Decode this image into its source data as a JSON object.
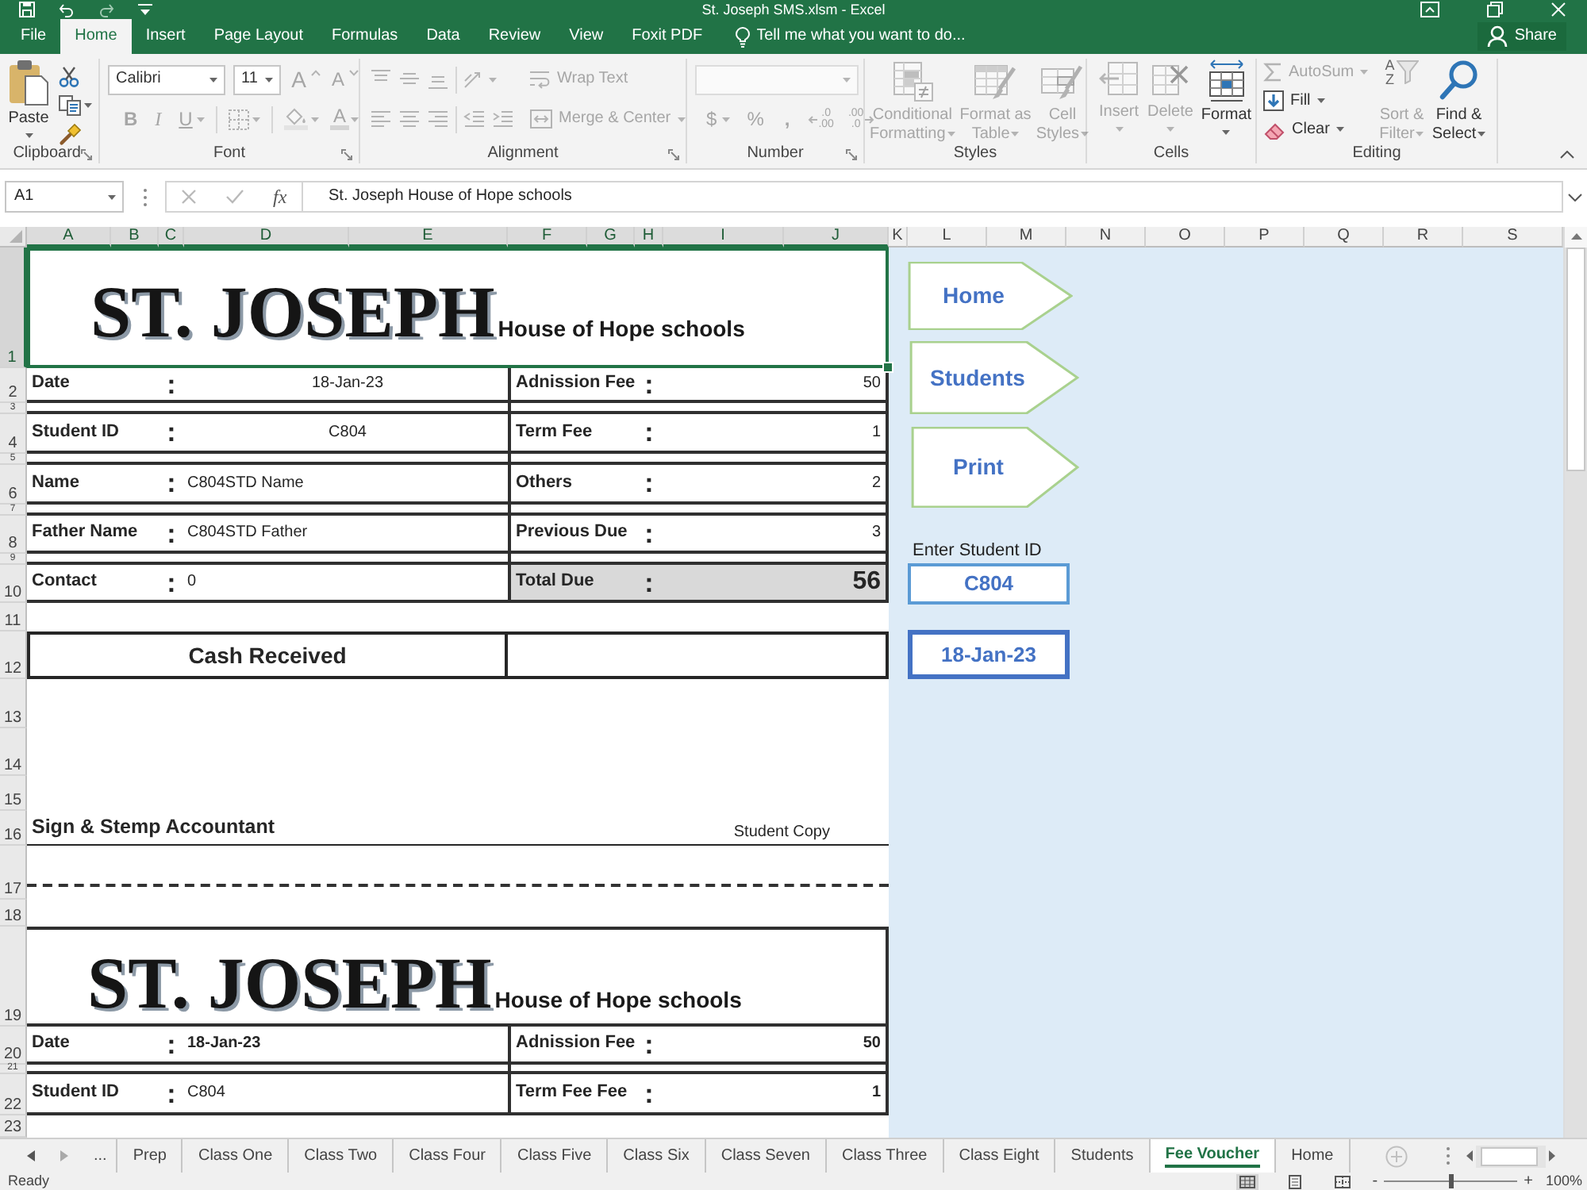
{
  "window": {
    "title": "St. Joseph SMS.xlsm - Excel"
  },
  "ribbon": {
    "tabs": [
      {
        "label": "File",
        "selected": false
      },
      {
        "label": "Home",
        "selected": true
      },
      {
        "label": "Insert",
        "selected": false
      },
      {
        "label": "Page Layout",
        "selected": false
      },
      {
        "label": "Formulas",
        "selected": false
      },
      {
        "label": "Data",
        "selected": false
      },
      {
        "label": "Review",
        "selected": false
      },
      {
        "label": "View",
        "selected": false
      },
      {
        "label": "Foxit PDF",
        "selected": false
      }
    ],
    "tell_me": {
      "placeholder": "Tell me what you want to do..."
    },
    "share": "Share",
    "groups": [
      {
        "label": "Clipboard",
        "items": [
          {
            "kind": "large",
            "label": "Paste",
            "disabled": false
          },
          {
            "kind": "icon",
            "disabled": false
          },
          {
            "kind": "icon",
            "disabled": false
          },
          {
            "kind": "icon",
            "disabled": false
          }
        ]
      },
      {
        "label": "Font",
        "items": [
          {
            "kind": "field",
            "value": "Calibri",
            "disabled": false
          },
          {
            "kind": "field",
            "value": "11",
            "disabled": false
          },
          {
            "kind": "letter",
            "label": "A",
            "disabled": true
          },
          {
            "kind": "letter",
            "label": "A",
            "disabled": true
          },
          {
            "kind": "letter",
            "label": "B",
            "disabled": true
          },
          {
            "kind": "letter",
            "label": "I",
            "disabled": true
          },
          {
            "kind": "letter",
            "label": "U",
            "disabled": true
          },
          {
            "kind": "icon",
            "disabled": true
          },
          {
            "kind": "icon",
            "disabled": true
          },
          {
            "kind": "letter",
            "label": "A",
            "disabled": true
          }
        ]
      },
      {
        "label": "Alignment",
        "items": [
          {
            "kind": "icon",
            "disabled": true
          },
          {
            "kind": "icon",
            "disabled": true
          },
          {
            "kind": "icon",
            "disabled": true
          },
          {
            "kind": "icon",
            "disabled": true
          },
          {
            "kind": "small",
            "label": "Wrap Text",
            "disabled": true
          },
          {
            "kind": "icon",
            "disabled": true
          },
          {
            "kind": "icon",
            "disabled": true
          },
          {
            "kind": "icon",
            "disabled": true
          },
          {
            "kind": "icon",
            "disabled": true
          },
          {
            "kind": "icon",
            "disabled": true
          },
          {
            "kind": "small",
            "label": "Merge & Center",
            "disabled": true
          }
        ]
      },
      {
        "label": "Number",
        "items": [
          {
            "kind": "field",
            "disabled": true
          },
          {
            "kind": "letter",
            "label": "$",
            "disabled": true
          },
          {
            "kind": "letter",
            "label": "%",
            "disabled": true
          },
          {
            "kind": "letter",
            "label": ",",
            "disabled": true
          },
          {
            "kind": "decimal",
            "lines": [
              ".0",
              ".00"
            ],
            "disabled": true
          },
          {
            "kind": "decimal",
            "lines": [
              ".00",
              ".0"
            ],
            "disabled": true
          }
        ]
      },
      {
        "label": "Styles",
        "items": [
          {
            "kind": "large",
            "label": "Conditional Formatting",
            "disabled": true
          },
          {
            "kind": "large",
            "label": "Format as Table",
            "disabled": true
          },
          {
            "kind": "large",
            "label": "Cell Styles",
            "disabled": true
          }
        ]
      },
      {
        "label": "Cells",
        "items": [
          {
            "kind": "large",
            "label": "Insert",
            "disabled": true
          },
          {
            "kind": "large",
            "label": "Delete",
            "disabled": true
          },
          {
            "kind": "large",
            "label": "Format",
            "disabled": false
          }
        ]
      },
      {
        "label": "Editing",
        "items": [
          {
            "kind": "small",
            "label": "AutoSum",
            "disabled": true
          },
          {
            "kind": "small",
            "label": "Fill",
            "disabled": false
          },
          {
            "kind": "small",
            "label": "Clear",
            "disabled": false
          },
          {
            "kind": "large",
            "label": "Sort & Filter",
            "icon_letters": [
              "A",
              "Z"
            ],
            "disabled": true
          },
          {
            "kind": "large",
            "label": "Find & Select",
            "disabled": false
          }
        ]
      }
    ]
  },
  "formula_bar": {
    "name_box": "A1",
    "buttons": [
      {
        "disabled": true
      },
      {
        "disabled": true
      }
    ],
    "function_label": "fx",
    "formula": "St. Joseph House of Hope schools"
  },
  "sheet": {
    "columns": [
      {
        "label": "A",
        "selected": true
      },
      {
        "label": "B",
        "selected": true
      },
      {
        "label": "C",
        "selected": true
      },
      {
        "label": "D",
        "selected": true
      },
      {
        "label": "E",
        "selected": true
      },
      {
        "label": "F",
        "selected": true
      },
      {
        "label": "G",
        "selected": true
      },
      {
        "label": "H",
        "selected": true
      },
      {
        "label": "I",
        "selected": true
      },
      {
        "label": "J",
        "selected": true
      },
      {
        "label": "K",
        "selected": false
      },
      {
        "label": "L",
        "selected": false
      },
      {
        "label": "M",
        "selected": false
      },
      {
        "label": "N",
        "selected": false
      },
      {
        "label": "O",
        "selected": false
      },
      {
        "label": "P",
        "selected": false
      },
      {
        "label": "Q",
        "selected": false
      },
      {
        "label": "R",
        "selected": false
      },
      {
        "label": "S",
        "selected": false
      }
    ],
    "rows": [
      {
        "label": "1",
        "selected": true
      },
      {
        "label": "2",
        "selected": false
      },
      {
        "label": "3",
        "selected": false
      },
      {
        "label": "4",
        "selected": false
      },
      {
        "label": "5",
        "selected": false
      },
      {
        "label": "6",
        "selected": false
      },
      {
        "label": "7",
        "selected": false
      },
      {
        "label": "8",
        "selected": false
      },
      {
        "label": "9",
        "selected": false
      },
      {
        "label": "10",
        "selected": false
      },
      {
        "label": "11",
        "selected": false
      },
      {
        "label": "12",
        "selected": false
      },
      {
        "label": "13",
        "selected": false
      },
      {
        "label": "14",
        "selected": false
      },
      {
        "label": "15",
        "selected": false
      },
      {
        "label": "16",
        "selected": false
      },
      {
        "label": "17",
        "selected": false
      },
      {
        "label": "18",
        "selected": false
      },
      {
        "label": "19",
        "selected": false
      },
      {
        "label": "20",
        "selected": false
      },
      {
        "label": "21",
        "selected": false
      },
      {
        "label": "22",
        "selected": false
      },
      {
        "label": "23",
        "selected": false
      }
    ],
    "copies": [
      {
        "title": "ST. JOSEPH",
        "subtitle": "House of Hope schools",
        "title_selected": true,
        "left": [
          {
            "label": "Date",
            "separator": ":",
            "value": "18-Jan-23"
          },
          {
            "label": "Student ID",
            "separator": ":",
            "value": "C804"
          },
          {
            "label": "Name",
            "separator": ":",
            "value": "C804STD Name"
          },
          {
            "label": "Father Name",
            "separator": ":",
            "value": "C804STD Father"
          },
          {
            "label": "Contact",
            "separator": ":",
            "value": "0"
          }
        ],
        "right": [
          {
            "label": "Adnission Fee",
            "separator": ":",
            "value": "50",
            "highlighted": false
          },
          {
            "label": "Term Fee",
            "separator": ":",
            "value": "1",
            "highlighted": false
          },
          {
            "label": "Others",
            "separator": ":",
            "value": "2",
            "highlighted": false
          },
          {
            "label": "Previous Due",
            "separator": ":",
            "value": "3",
            "highlighted": false
          },
          {
            "label": "Total Due",
            "separator": ":",
            "value": "56",
            "highlighted": true
          }
        ],
        "cash_label": "Cash Received",
        "signature": "Sign & Stemp Accountant",
        "copy_label": "Student Copy"
      },
      {
        "title": "ST. JOSEPH",
        "subtitle": "House of Hope schools",
        "title_selected": false,
        "left": [
          {
            "label": "Date",
            "separator": ":",
            "value": "18-Jan-23"
          },
          {
            "label": "Student ID",
            "separator": ":",
            "value": "C804"
          }
        ],
        "right": [
          {
            "label": "Adnission Fee",
            "separator": ":",
            "value": "50",
            "highlighted": false
          },
          {
            "label": "Term Fee Fee",
            "separator": ":",
            "value": "1",
            "highlighted": false
          }
        ]
      }
    ],
    "shapes": {
      "buttons": [
        {
          "label": "Home"
        },
        {
          "label": "Students"
        },
        {
          "label": "Print"
        }
      ],
      "student_id": {
        "label": "Enter Student ID",
        "value": "C804"
      },
      "date": "18-Jan-23"
    }
  },
  "sheet_tabs": {
    "navigation": [
      {
        "disabled": false
      },
      {
        "disabled": true
      }
    ],
    "more": "...",
    "tabs": [
      {
        "label": "Prep",
        "selected": false
      },
      {
        "label": "Class One",
        "selected": false
      },
      {
        "label": "Class Two",
        "selected": false
      },
      {
        "label": "Class Four",
        "selected": false
      },
      {
        "label": "Class Five",
        "selected": false
      },
      {
        "label": "Class Six",
        "selected": false
      },
      {
        "label": "Class Seven",
        "selected": false
      },
      {
        "label": "Class Three",
        "selected": false
      },
      {
        "label": "Class Eight",
        "selected": false
      },
      {
        "label": "Students",
        "selected": false
      },
      {
        "label": "Fee Voucher",
        "selected": true
      },
      {
        "label": "Home",
        "selected": false
      }
    ],
    "new_sheet": {
      "disabled": true
    }
  },
  "status_bar": {
    "status": "Ready",
    "views": [
      {
        "selected": true
      },
      {
        "selected": false
      },
      {
        "selected": false
      }
    ],
    "zoom": {
      "minus": "-",
      "plus": "+",
      "level": 0.5,
      "reading": "100%"
    }
  }
}
